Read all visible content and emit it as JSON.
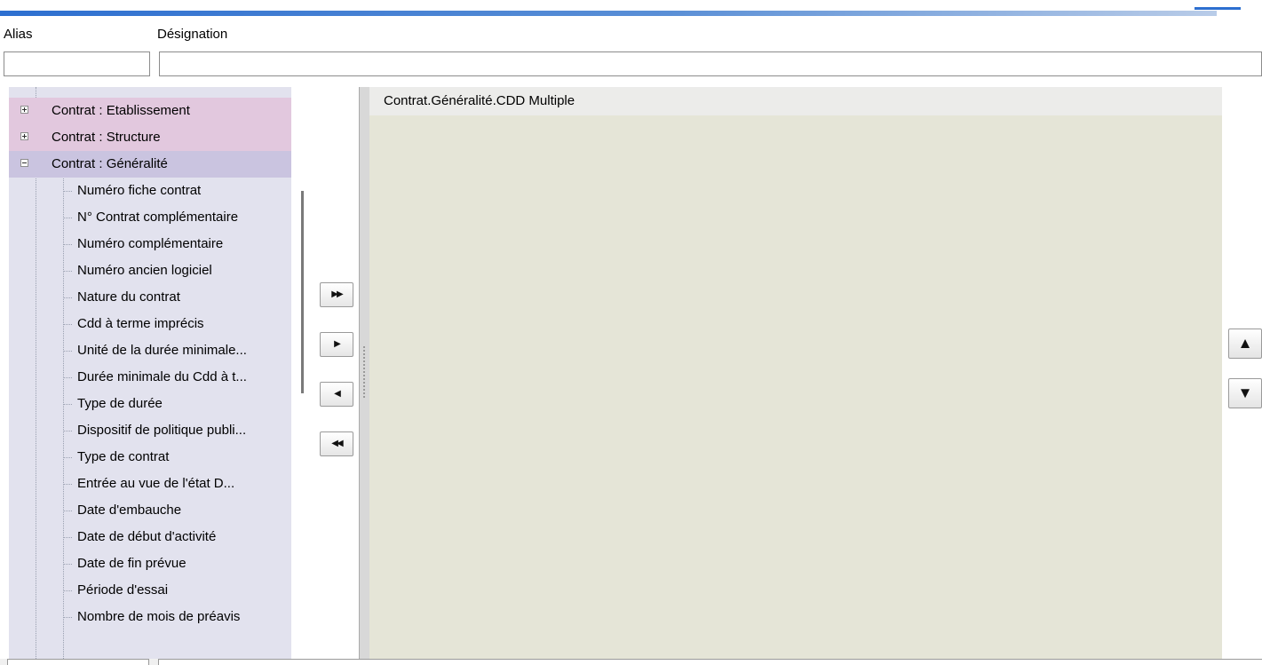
{
  "filters": {
    "alias_label": "Alias",
    "designation_label": "Désignation",
    "alias_value": "",
    "designation_value": ""
  },
  "tree": {
    "categories": [
      {
        "label": "Contrat : Etablissement",
        "expanded": false
      },
      {
        "label": "Contrat : Structure",
        "expanded": false
      },
      {
        "label": "Contrat : Généralité",
        "expanded": true
      }
    ],
    "fields": [
      "Numéro fiche contrat",
      "N° Contrat complémentaire",
      "Numéro complémentaire",
      "Numéro ancien logiciel",
      "Nature du contrat",
      "Cdd à terme imprécis",
      "Unité de la durée minimale...",
      "Durée minimale du Cdd à t...",
      "Type de durée",
      "Dispositif de politique publi...",
      "Type de contrat",
      "Entrée au vue de l'état D...",
      "Date d'embauche",
      "Date de début d'activité",
      "Date de fin prévue",
      "Période d'essai",
      "Nombre de mois de préavis"
    ]
  },
  "transfer_buttons": {
    "add_all": "▶▶",
    "add_one": "▶",
    "remove_one": "◀",
    "remove_all": "◀◀"
  },
  "selection": {
    "header": "Contrat.Généralité.CDD Multiple"
  },
  "order_buttons": {
    "move_up": "▲",
    "move_down": "▼"
  },
  "colors": {
    "accent": "#2d6fd0",
    "tree_background": "#e2e2ee",
    "category_background": "#e2c8de",
    "expanded_category_background": "#cac4e0",
    "selection_background": "#e5e5d7"
  }
}
